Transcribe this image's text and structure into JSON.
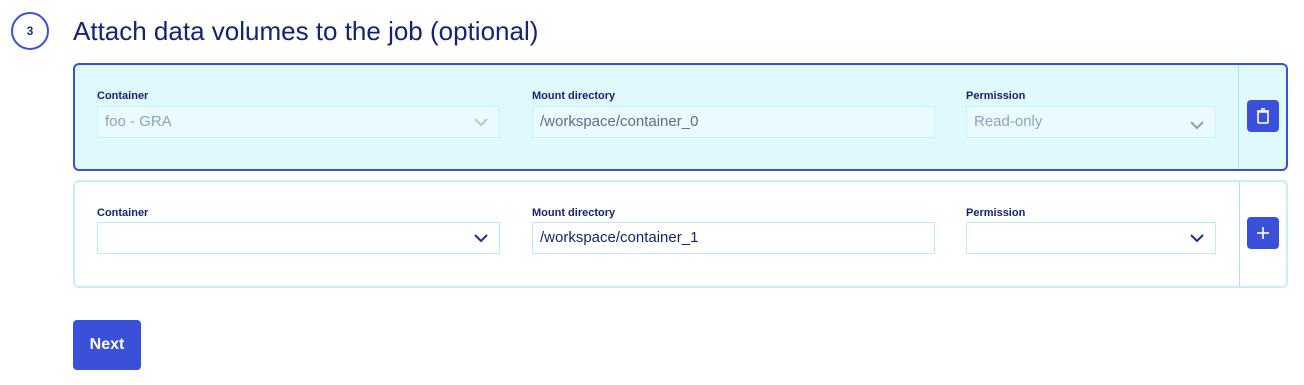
{
  "step": {
    "number": "3",
    "title": "Attach data volumes to the job (optional)"
  },
  "labels": {
    "container": "Container",
    "mount": "Mount directory",
    "permission": "Permission"
  },
  "volumes": [
    {
      "container": "foo - GRA",
      "mount": "/workspace/container_0",
      "permission": "Read-only",
      "action": "delete-icon"
    },
    {
      "container": "",
      "mount": "/workspace/container_1",
      "permission": "",
      "action": "plus-icon"
    }
  ],
  "next_label": "Next",
  "colors": {
    "accent": "#3b50d8",
    "active_bg": "#e0f9fd",
    "text": "#14237a"
  }
}
